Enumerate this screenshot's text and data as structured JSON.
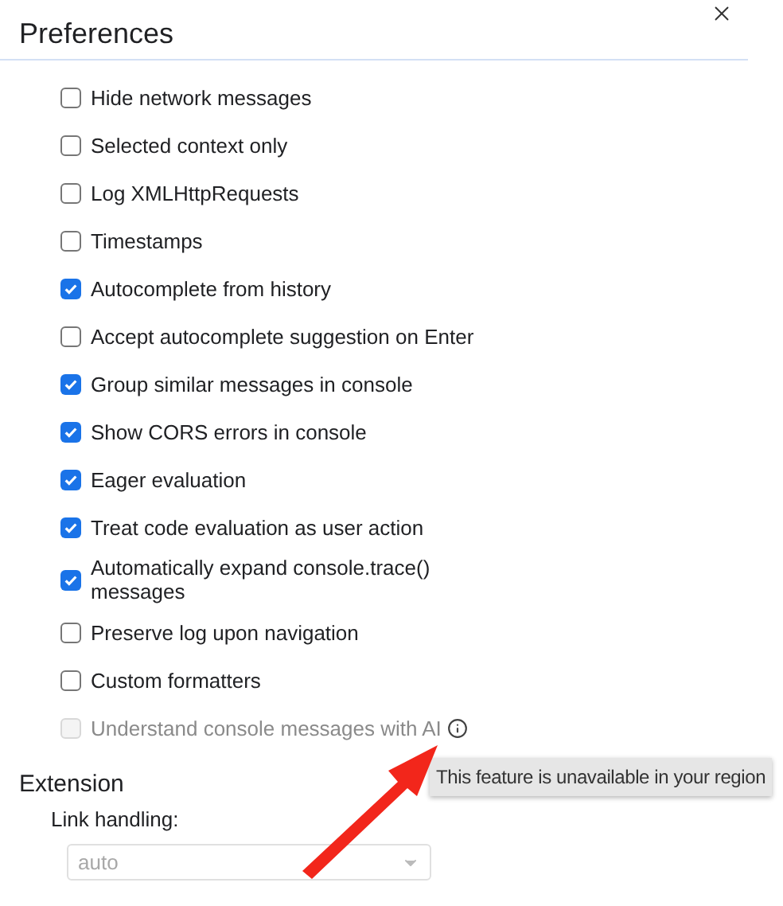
{
  "dialog": {
    "title": "Preferences"
  },
  "console": {
    "settings": [
      {
        "label": "Hide network messages",
        "checked": false,
        "disabled": false
      },
      {
        "label": "Selected context only",
        "checked": false,
        "disabled": false
      },
      {
        "label": "Log XMLHttpRequests",
        "checked": false,
        "disabled": false
      },
      {
        "label": "Timestamps",
        "checked": false,
        "disabled": false
      },
      {
        "label": "Autocomplete from history",
        "checked": true,
        "disabled": false
      },
      {
        "label": "Accept autocomplete suggestion on Enter",
        "checked": false,
        "disabled": false
      },
      {
        "label": "Group similar messages in console",
        "checked": true,
        "disabled": false
      },
      {
        "label": "Show CORS errors in console",
        "checked": true,
        "disabled": false
      },
      {
        "label": "Eager evaluation",
        "checked": true,
        "disabled": false
      },
      {
        "label": "Treat code evaluation as user action",
        "checked": true,
        "disabled": false
      },
      {
        "label": "Automatically expand console.trace() messages",
        "checked": true,
        "disabled": false
      },
      {
        "label": "Preserve log upon navigation",
        "checked": false,
        "disabled": false
      },
      {
        "label": "Custom formatters",
        "checked": false,
        "disabled": false
      },
      {
        "label": "Understand console messages with AI",
        "checked": false,
        "disabled": true,
        "info": true
      }
    ]
  },
  "tooltip": {
    "text": "This feature is unavailable in your region"
  },
  "extension": {
    "heading": "Extension",
    "link_handling": {
      "label": "Link handling:",
      "value": "auto",
      "disabled": true
    }
  }
}
